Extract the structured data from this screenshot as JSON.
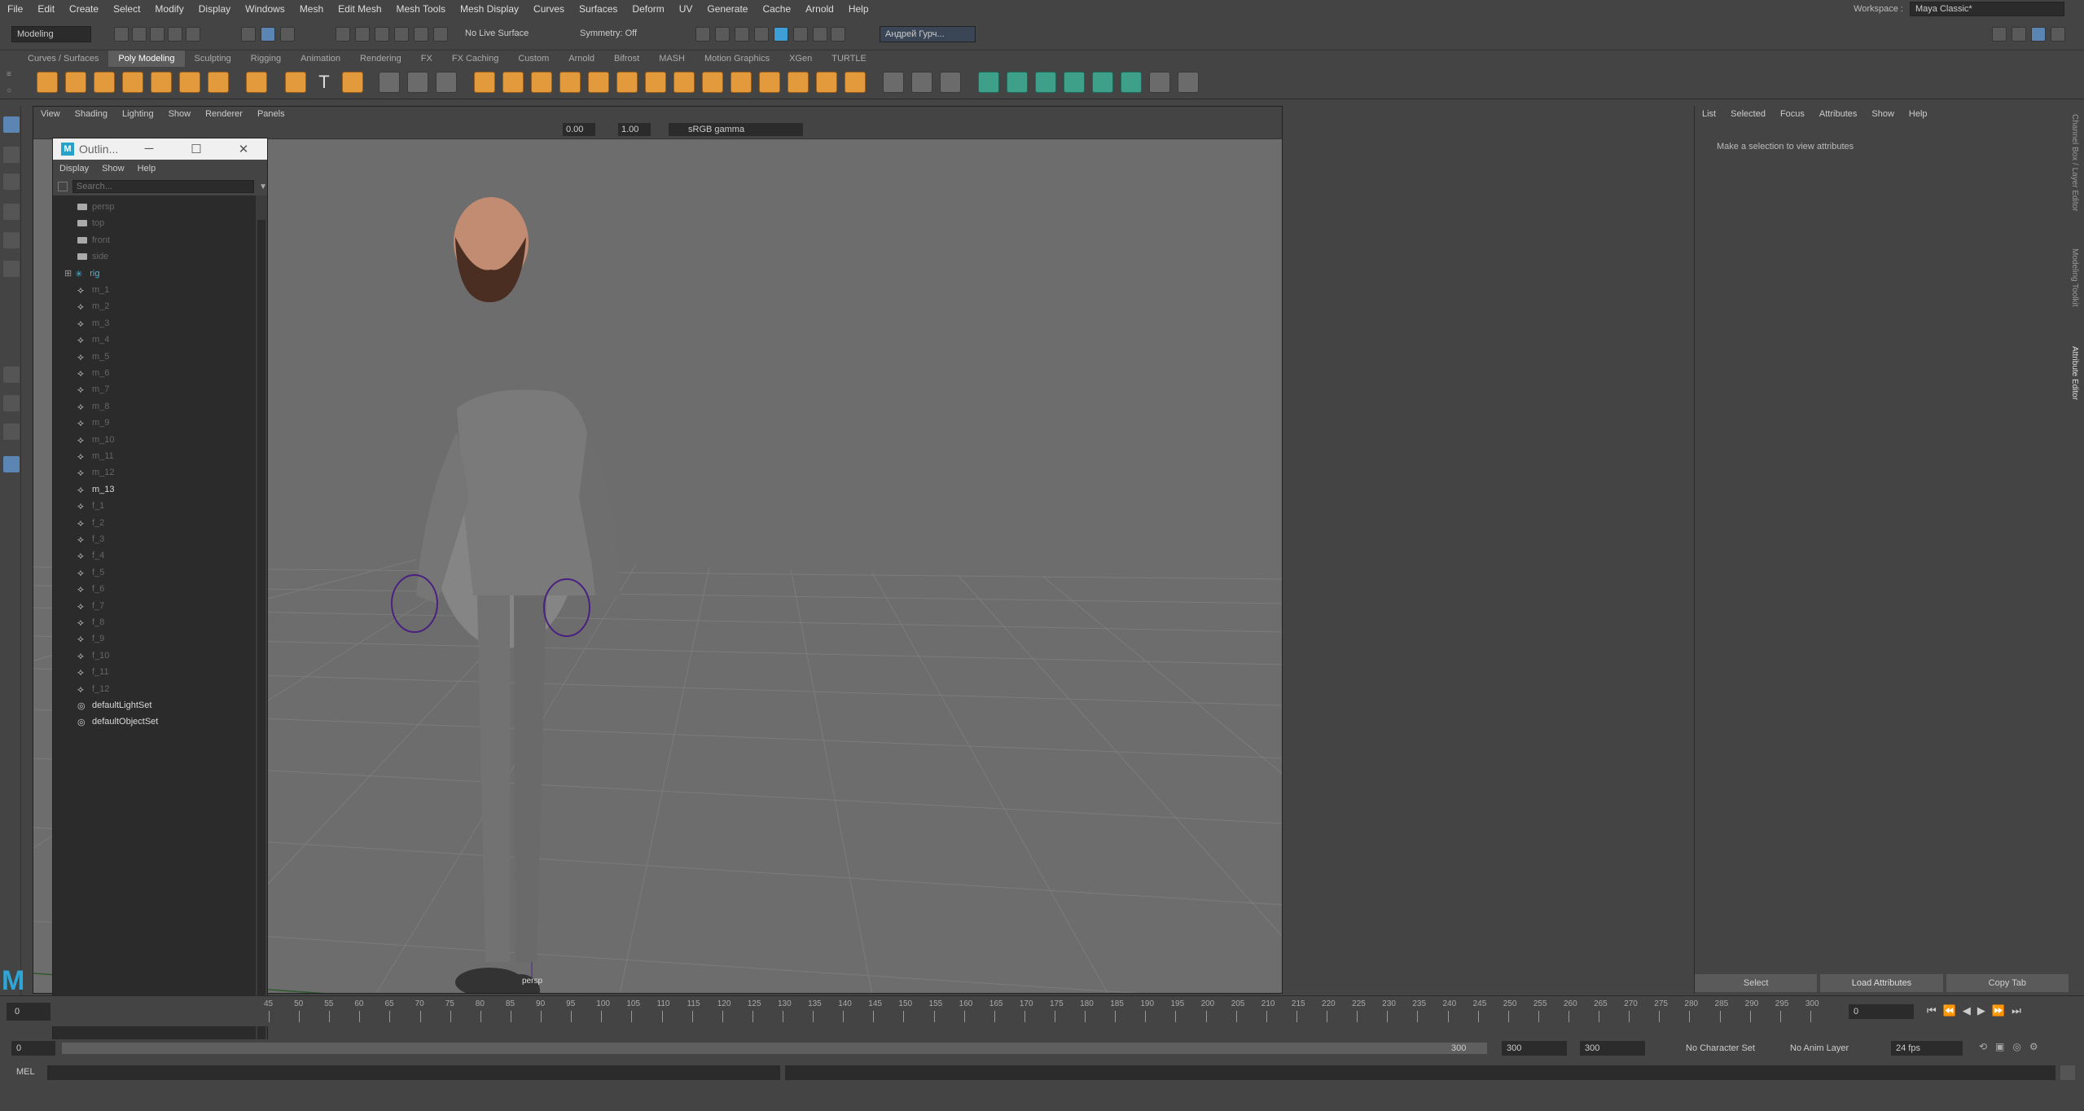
{
  "menubar": {
    "items": [
      "File",
      "Edit",
      "Create",
      "Select",
      "Modify",
      "Display",
      "Windows",
      "Mesh",
      "Edit Mesh",
      "Mesh Tools",
      "Mesh Display",
      "Curves",
      "Surfaces",
      "Deform",
      "UV",
      "Generate",
      "Cache",
      "Arnold",
      "Help"
    ],
    "workspace_label": "Workspace :",
    "workspace_value": "Maya Classic*"
  },
  "statusline": {
    "mode": "Modeling",
    "live_surface": "No Live Surface",
    "symmetry": "Symmetry: Off",
    "user": "Андрей Гурч..."
  },
  "shelf": {
    "tabs": [
      "Curves / Surfaces",
      "Poly Modeling",
      "Sculpting",
      "Rigging",
      "Animation",
      "Rendering",
      "FX",
      "FX Caching",
      "Custom",
      "Arnold",
      "Bifrost",
      "MASH",
      "Motion Graphics",
      "XGen",
      "TURTLE"
    ],
    "active_tab": "Poly Modeling"
  },
  "viewport": {
    "menu": [
      "View",
      "Shading",
      "Lighting",
      "Show",
      "Renderer",
      "Panels"
    ],
    "exposure": "0.00",
    "gamma": "1.00",
    "color_space": "sRGB gamma",
    "camera_label": "persp"
  },
  "outliner": {
    "title": "Outlin...",
    "menu": [
      "Display",
      "Show",
      "Help"
    ],
    "search_placeholder": "Search...",
    "items": [
      {
        "label": "persp",
        "kind": "cam",
        "bright": false
      },
      {
        "label": "top",
        "kind": "cam",
        "bright": false
      },
      {
        "label": "front",
        "kind": "cam",
        "bright": false
      },
      {
        "label": "side",
        "kind": "cam",
        "bright": false
      },
      {
        "label": "rig",
        "kind": "rig",
        "bright": false
      },
      {
        "label": "m_1",
        "kind": "jnt",
        "bright": false
      },
      {
        "label": "m_2",
        "kind": "jnt",
        "bright": false
      },
      {
        "label": "m_3",
        "kind": "jnt",
        "bright": false
      },
      {
        "label": "m_4",
        "kind": "jnt",
        "bright": false
      },
      {
        "label": "m_5",
        "kind": "jnt",
        "bright": false
      },
      {
        "label": "m_6",
        "kind": "jnt",
        "bright": false
      },
      {
        "label": "m_7",
        "kind": "jnt",
        "bright": false
      },
      {
        "label": "m_8",
        "kind": "jnt",
        "bright": false
      },
      {
        "label": "m_9",
        "kind": "jnt",
        "bright": false
      },
      {
        "label": "m_10",
        "kind": "jnt",
        "bright": false
      },
      {
        "label": "m_11",
        "kind": "jnt",
        "bright": false
      },
      {
        "label": "m_12",
        "kind": "jnt",
        "bright": false
      },
      {
        "label": "m_13",
        "kind": "jnt",
        "bright": true
      },
      {
        "label": "f_1",
        "kind": "jnt",
        "bright": false
      },
      {
        "label": "f_2",
        "kind": "jnt",
        "bright": false
      },
      {
        "label": "f_3",
        "kind": "jnt",
        "bright": false
      },
      {
        "label": "f_4",
        "kind": "jnt",
        "bright": false
      },
      {
        "label": "f_5",
        "kind": "jnt",
        "bright": false
      },
      {
        "label": "f_6",
        "kind": "jnt",
        "bright": false
      },
      {
        "label": "f_7",
        "kind": "jnt",
        "bright": false
      },
      {
        "label": "f_8",
        "kind": "jnt",
        "bright": false
      },
      {
        "label": "f_9",
        "kind": "jnt",
        "bright": false
      },
      {
        "label": "f_10",
        "kind": "jnt",
        "bright": false
      },
      {
        "label": "f_11",
        "kind": "jnt",
        "bright": false
      },
      {
        "label": "f_12",
        "kind": "jnt",
        "bright": false
      },
      {
        "label": "defaultLightSet",
        "kind": "set",
        "bright": true
      },
      {
        "label": "defaultObjectSet",
        "kind": "set",
        "bright": true
      }
    ]
  },
  "attribute_editor": {
    "menu": [
      "List",
      "Selected",
      "Focus",
      "Attributes",
      "Show",
      "Help"
    ],
    "message": "Make a selection to view attributes",
    "buttons": [
      "Select",
      "Load Attributes",
      "Copy Tab"
    ],
    "side_tabs": [
      "Channel Box / Layer Editor",
      "Modeling Toolkit",
      "Attribute Editor"
    ]
  },
  "timeslider": {
    "ticks": [
      "45",
      "50",
      "55",
      "60",
      "65",
      "70",
      "75",
      "80",
      "85",
      "90",
      "95",
      "100",
      "105",
      "110",
      "115",
      "120",
      "125",
      "130",
      "135",
      "140",
      "145",
      "150",
      "155",
      "160",
      "165",
      "170",
      "175",
      "180",
      "185",
      "190",
      "195",
      "200",
      "205",
      "210",
      "215",
      "220",
      "225",
      "230",
      "235",
      "240",
      "245",
      "250",
      "255",
      "260",
      "265",
      "270",
      "275",
      "280",
      "285",
      "290",
      "295",
      "300"
    ],
    "current_frame": "0",
    "start_frame": "0"
  },
  "rangeslider": {
    "start": "0",
    "range_end": "300",
    "end_a": "300",
    "end_b": "300",
    "character_set": "No Character Set",
    "anim_layer": "No Anim Layer",
    "fps": "24 fps"
  },
  "cmdline": {
    "label": "MEL"
  }
}
